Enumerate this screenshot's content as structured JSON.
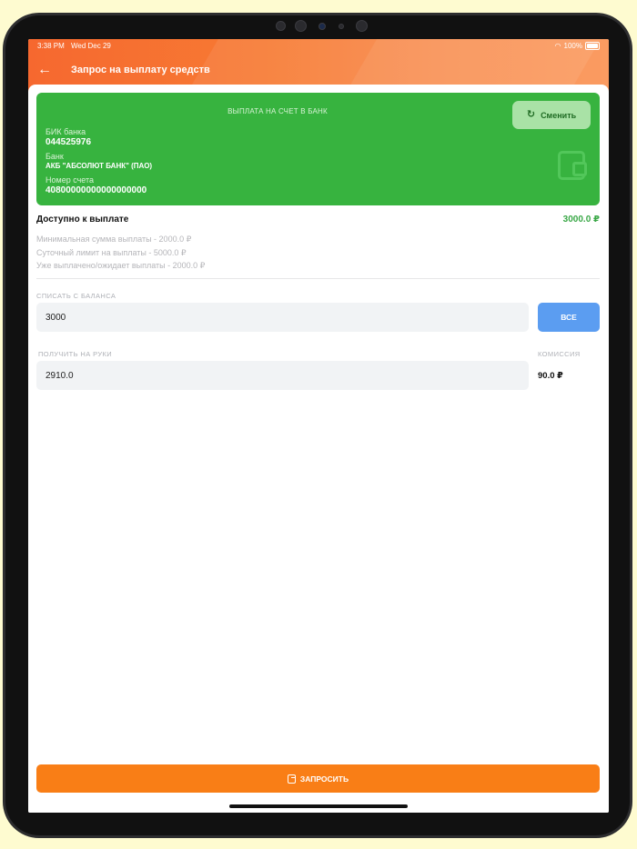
{
  "status_bar": {
    "time": "3:38 PM",
    "date": "Wed Dec 29",
    "battery": "100%"
  },
  "header": {
    "title": "Запрос на выплату средств",
    "back_icon": "arrow-left-icon"
  },
  "bank_card": {
    "heading": "ВЫПЛАТА НА СЧЕТ В БАНК",
    "change_button": "Сменить",
    "bik_label": "БИК банка",
    "bik_value": "044525976",
    "bank_label": "Банк",
    "bank_value": "АКБ \"АБСОЛЮТ БАНК\" (ПАО)",
    "account_label": "Номер счета",
    "account_value": "40800000000000000000"
  },
  "available": {
    "label": "Доступно к выплате",
    "value": "3000.0 ₽"
  },
  "limits": [
    "Минимальная сумма выплаты - 2000.0 ₽",
    "Суточный лимит на выплаты - 5000.0 ₽",
    "Уже выплачено/ожидает выплаты - 2000.0 ₽"
  ],
  "form": {
    "debit_caption": "СПИСАТЬ С БАЛАНСА",
    "debit_value": "3000",
    "all_button": "ВСЕ",
    "receive_caption": "ПОЛУЧИТЬ НА РУКИ",
    "receive_value": "2910.0",
    "commission_caption": "КОМИССИЯ",
    "commission_value": "90.0 ₽"
  },
  "submit_button": "ЗАПРОСИТЬ",
  "colors": {
    "header_orange": "#f77a33",
    "card_green": "#37b33f",
    "accent_blue": "#5b9df1",
    "submit_orange": "#f97e16"
  }
}
